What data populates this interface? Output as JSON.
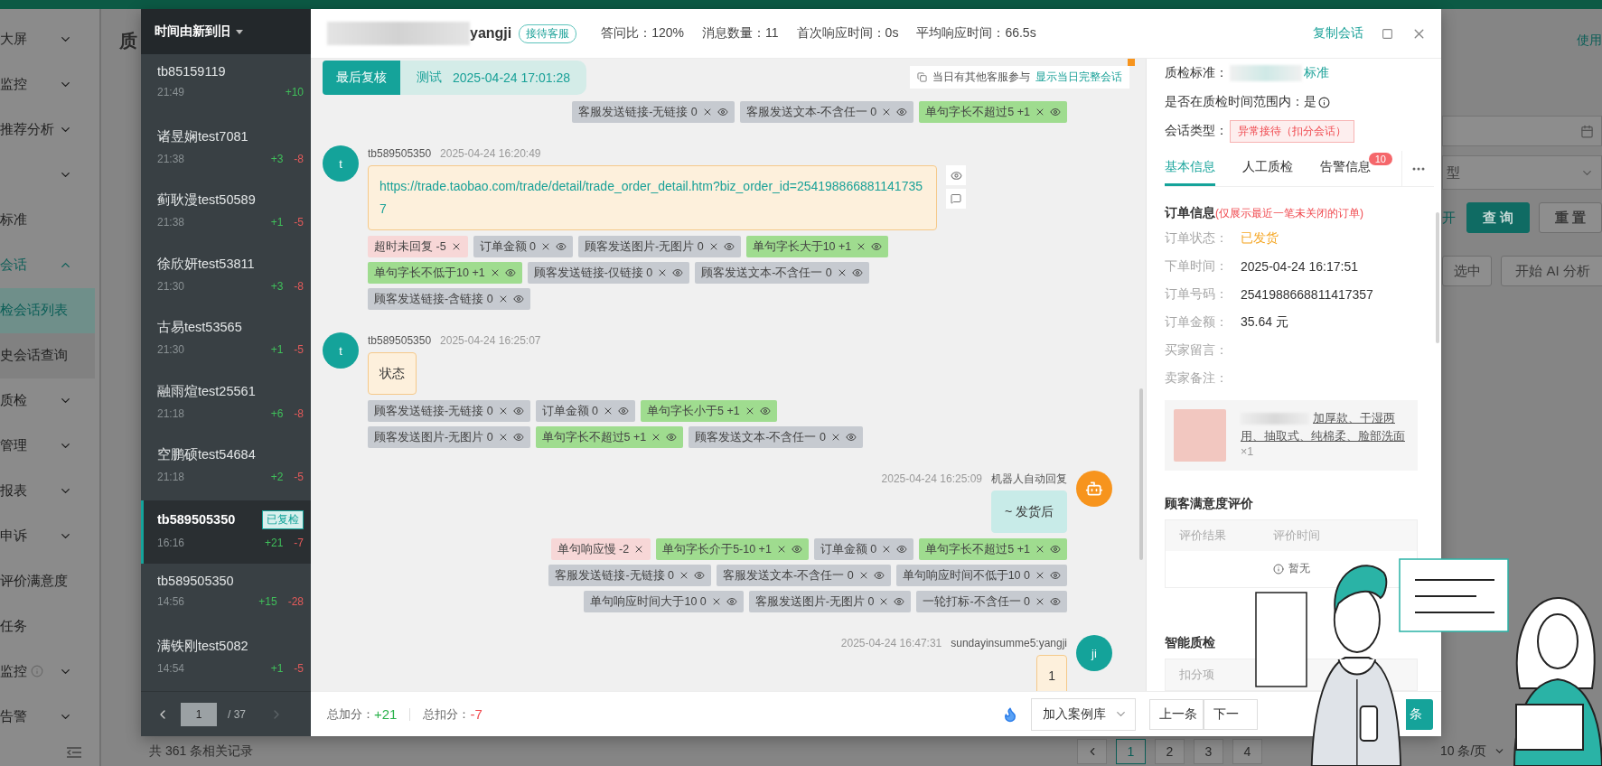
{
  "page": {
    "title_fragment": "质",
    "help_link": "使用",
    "filter_select_fragment": "型",
    "filter_label_fragment": "开",
    "search_button": "查 询",
    "reset_button": "重 置",
    "select_button_fragment": "选中",
    "ai_button": "开始 AI 分析",
    "total_records": "共 361 条相关记录",
    "pages": [
      {
        "label": "1",
        "selected": true
      },
      {
        "label": "2",
        "selected": false
      },
      {
        "label": "3",
        "selected": false
      },
      {
        "label": "4",
        "selected": false
      }
    ],
    "page_size": "10 条/页"
  },
  "nav": [
    {
      "label": "大屏",
      "kind": "group",
      "expanded": false,
      "info": false
    },
    {
      "label": "监控",
      "kind": "group",
      "expanded": false,
      "info": false
    },
    {
      "label": "推荐分析",
      "kind": "group",
      "expanded": false,
      "info": false
    },
    {
      "kind": "group",
      "expanded": false,
      "info": false
    },
    {
      "label": "标准",
      "kind": "link",
      "info": false
    },
    {
      "label": "会话",
      "kind": "group",
      "expanded": true,
      "info": false,
      "children": [
        {
          "label": "检会话列表",
          "selected": true
        },
        {
          "label": "史会话查询",
          "selected": false
        }
      ]
    },
    {
      "label": "质检",
      "kind": "group",
      "expanded": false,
      "info": false
    },
    {
      "label": "管理",
      "kind": "group",
      "expanded": false,
      "info": false
    },
    {
      "label": "报表",
      "kind": "group",
      "expanded": false,
      "info": false
    },
    {
      "label": "申诉",
      "kind": "group",
      "expanded": false,
      "info": false
    },
    {
      "label": "评价满意度",
      "kind": "link",
      "info": false
    },
    {
      "label": "任务",
      "kind": "link",
      "info": false
    },
    {
      "label": "监控",
      "kind": "group",
      "expanded": false,
      "info": true
    },
    {
      "label": "告警",
      "kind": "group",
      "expanded": false,
      "info": false
    }
  ],
  "session_list": {
    "sort_label": "时间由新到旧",
    "items": [
      {
        "name": "tb85159119",
        "time": "21:49",
        "plus": "+10",
        "selected": false
      },
      {
        "name": "诸昱娴test7081",
        "time": "21:38",
        "plus": "+3",
        "minus": "-8",
        "selected": false
      },
      {
        "name": "蓟耿漫test50589",
        "time": "21:38",
        "plus": "+1",
        "minus": "-5",
        "selected": false
      },
      {
        "name": "徐欣妍test53811",
        "time": "21:30",
        "plus": "+3",
        "minus": "-8",
        "selected": false
      },
      {
        "name": "古易test53565",
        "time": "21:30",
        "plus": "+1",
        "minus": "-5",
        "selected": false
      },
      {
        "name": "融雨煊test25561",
        "time": "21:18",
        "plus": "+6",
        "minus": "-8",
        "selected": false
      },
      {
        "name": "空鹏硕test54684",
        "time": "21:18",
        "plus": "+2",
        "minus": "-5",
        "selected": false
      },
      {
        "name": "tb589505350",
        "time": "16:16",
        "plus": "+21",
        "minus": "-7",
        "selected": true,
        "badge": "已复检"
      },
      {
        "name": "tb589505350",
        "time": "14:56",
        "plus": "+15",
        "minus": "-28",
        "selected": false
      },
      {
        "name": "满铁刚test5082",
        "time": "14:54",
        "plus": "+1",
        "minus": "-5",
        "selected": false
      }
    ],
    "pager": {
      "page": "1",
      "total": "/ 37"
    }
  },
  "header": {
    "agent_name": "yangji",
    "agent_badge": "接待客服",
    "stats": [
      "答问比：120%",
      "消息数量：11",
      "首次响应时间：0s",
      "平均响应时间：66.5s"
    ],
    "copy_link": "复制会话"
  },
  "review_bar": {
    "label": "最后复核",
    "reviewer": "测试",
    "time": "2025-04-24 17:01:28"
  },
  "notice": {
    "text": "当日有其他客服参与",
    "link": "显示当日完整会话"
  },
  "messages": [
    {
      "kind": "tags",
      "tag_rows": [
        [
          {
            "text": "客服发送链接-无链接 0",
            "kind": "neutral"
          },
          {
            "text": "客服发送文本-不含任一 0",
            "kind": "neutral"
          },
          {
            "text": "单句字长不超过5 +1",
            "kind": "bonus"
          }
        ]
      ]
    },
    {
      "kind": "customer",
      "avatar": "t",
      "sender": "tb589505350",
      "time": "2025-04-24 16:20:49",
      "text": "https://trade.taobao.com/trade/detail/trade_order_detail.htm?biz_order_id=2541988668811417357",
      "link": true,
      "actions": true,
      "tag_rows": [
        [
          {
            "text": "超时未回复 -5",
            "kind": "penalty"
          },
          {
            "text": "订单金额 0",
            "kind": "neutral"
          },
          {
            "text": "顾客发送图片-无图片 0",
            "kind": "neutral"
          },
          {
            "text": "单句字长大于10 +1",
            "kind": "bonus"
          }
        ],
        [
          {
            "text": "单句字长不低于10 +1",
            "kind": "bonus"
          },
          {
            "text": "顾客发送链接-仅链接 0",
            "kind": "neutral"
          },
          {
            "text": "顾客发送文本-不含任一 0",
            "kind": "neutral"
          }
        ],
        [
          {
            "text": "顾客发送链接-含链接 0",
            "kind": "neutral"
          }
        ]
      ]
    },
    {
      "kind": "customer",
      "avatar": "t",
      "sender": "tb589505350",
      "time": "2025-04-24 16:25:07",
      "text": "状态",
      "link": false,
      "tag_rows": [
        [
          {
            "text": "顾客发送链接-无链接 0",
            "kind": "neutral"
          },
          {
            "text": "订单金额 0",
            "kind": "neutral"
          },
          {
            "text": "单句字长小于5 +1",
            "kind": "bonus"
          }
        ],
        [
          {
            "text": "顾客发送图片-无图片 0",
            "kind": "neutral"
          },
          {
            "text": "单句字长不超过5 +1",
            "kind": "bonus"
          },
          {
            "text": "顾客发送文本-不含任一 0",
            "kind": "neutral"
          }
        ]
      ]
    },
    {
      "kind": "robot",
      "sender": "机器人自动回复",
      "time": "2025-04-24 16:25:09",
      "text": "~ 发货后",
      "link": false,
      "tag_rows": [
        [
          {
            "text": "单句响应慢 -2",
            "kind": "penalty"
          },
          {
            "text": "单句字长介于5-10 +1",
            "kind": "bonus"
          },
          {
            "text": "订单金额 0",
            "kind": "neutral"
          },
          {
            "text": "单句字长不超过5 +1",
            "kind": "bonus"
          }
        ],
        [
          {
            "text": "客服发送链接-无链接 0",
            "kind": "neutral"
          },
          {
            "text": "客服发送文本-不含任一 0",
            "kind": "neutral"
          },
          {
            "text": "单句响应时间不低于10 0",
            "kind": "neutral"
          }
        ],
        [
          {
            "text": "单句响应时间大于10 0",
            "kind": "neutral"
          },
          {
            "text": "客服发送图片-无图片 0",
            "kind": "neutral"
          },
          {
            "text": "一轮打标-不含任一 0",
            "kind": "neutral"
          }
        ]
      ]
    },
    {
      "kind": "agent",
      "avatar": "ji",
      "sender": "sundayinsumme5:yangji",
      "time": "2025-04-24 16:47:31",
      "text": "1",
      "link": false
    }
  ],
  "qc_info": {
    "standard_label": "质检标准：",
    "standard_suffix": "标准",
    "in_range": "是否在质检时间范围内：是",
    "type_label": "会话类型：",
    "type_badge": "异常接待（扣分会话）"
  },
  "tabs": [
    {
      "label": "基本信息",
      "selected": true
    },
    {
      "label": "人工质检",
      "selected": false
    },
    {
      "label": "告警信息",
      "selected": false,
      "badge": "10"
    }
  ],
  "order": {
    "title": "订单信息",
    "note": "(仅展示最近一笔未关闭的订单)",
    "fields": [
      {
        "label": "订单状态：",
        "value": "已发货",
        "kind": "status"
      },
      {
        "label": "下单时间：",
        "value": "2025-04-24 16:17:51",
        "kind": "plain"
      },
      {
        "label": "订单号码：",
        "value": "2541988668811417357",
        "kind": "plain"
      },
      {
        "label": "订单金额：",
        "value": "35.64 元",
        "kind": "plain"
      },
      {
        "label": "买家留言：",
        "kind": "plain"
      },
      {
        "label": "卖家备注：",
        "kind": "plain"
      }
    ],
    "product": {
      "name": "加厚款、干湿两用、抽取式、纯棉柔、脸部洗面",
      "quantity": "×1"
    }
  },
  "satisfaction": {
    "title": "顾客满意度评价",
    "columns": [
      "评价结果",
      "评价时间"
    ],
    "empty": "暂无"
  },
  "smart_qc": {
    "title": "智能质检",
    "columns": [
      "扣分项"
    ]
  },
  "footer": {
    "bonus_label": "总加分：",
    "bonus": "+21",
    "penalty_label": "总扣分：",
    "penalty": "-7",
    "case_select": "加入案例库",
    "prev": "上一条",
    "next": "下一",
    "submit": "条"
  }
}
